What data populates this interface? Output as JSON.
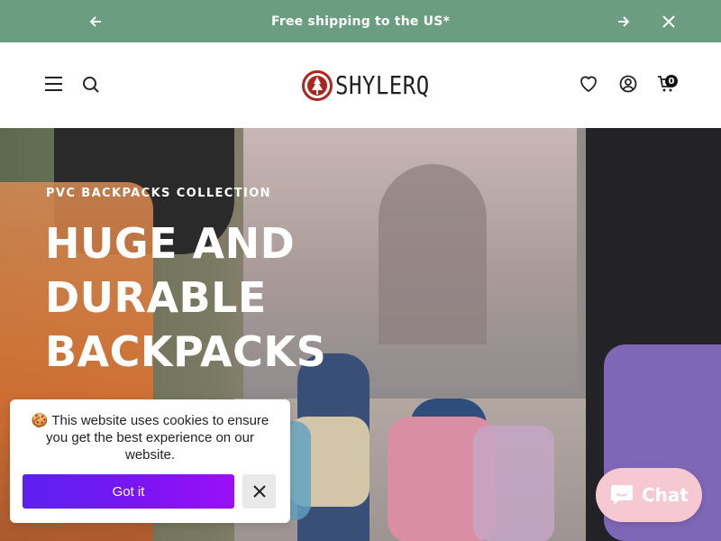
{
  "announcement": {
    "message": "Free shipping to the US*",
    "prev_icon": "arrow-left-icon",
    "next_icon": "arrow-right-icon",
    "close_icon": "close-icon",
    "background": "#6b9d80"
  },
  "header": {
    "brand": "SHYLERQ",
    "icons": [
      "menu-icon",
      "search-icon",
      "heart-icon",
      "account-icon",
      "cart-icon"
    ],
    "cart_count": "0"
  },
  "hero": {
    "eyebrow": "PVC BACKPACKS COLLECTION",
    "headline": "HUGE AND DURABLE BACKPACKS"
  },
  "cookie_banner": {
    "message": "🍪 This website uses cookies to ensure you get the best experience on our website.",
    "accept_label": "Got it",
    "dismiss_icon": "close-icon",
    "accent": "#6b18f2"
  },
  "chat": {
    "label": "Chat",
    "icon": "chat-bubble-icon",
    "background": "#f6c8d2"
  }
}
